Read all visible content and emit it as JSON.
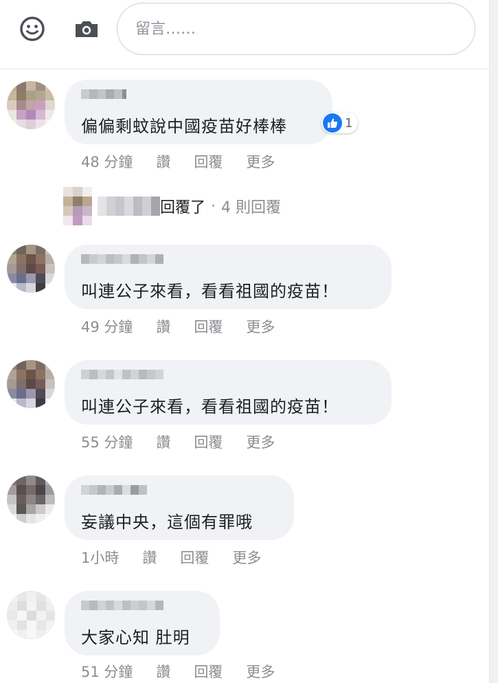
{
  "composer": {
    "placeholder": "留言……"
  },
  "colors": {
    "bubble_bg": "#f0f2f5",
    "meta_text": "#8a8d91",
    "like_blue": "#1877f2"
  },
  "comments": [
    {
      "text": "偏偏剩蚊說中國疫苗好棒棒",
      "reaction_icon": "like-icon",
      "reaction_count": "1",
      "time": "48 分鐘",
      "like_label": "讚",
      "reply_label": "回覆",
      "more_label": "更多"
    },
    {
      "text": "叫連公子來看，看看祖國的疫苗！",
      "time": "49 分鐘",
      "like_label": "讚",
      "reply_label": "回覆",
      "more_label": "更多"
    },
    {
      "text": "叫連公子來看，看看祖國的疫苗！",
      "time": "55 分鐘",
      "like_label": "讚",
      "reply_label": "回覆",
      "more_label": "更多"
    },
    {
      "text": "妄議中央，這個有罪哦",
      "time": "1小時",
      "like_label": "讚",
      "reply_label": "回覆",
      "more_label": "更多"
    },
    {
      "text": "大家心知 肚明",
      "time": "51 分鐘",
      "like_label": "讚",
      "reply_label": "回覆",
      "more_label": "更多"
    }
  ],
  "replies_summary": {
    "label": "回覆了",
    "separator": "·",
    "count_text": "4 則回覆"
  }
}
